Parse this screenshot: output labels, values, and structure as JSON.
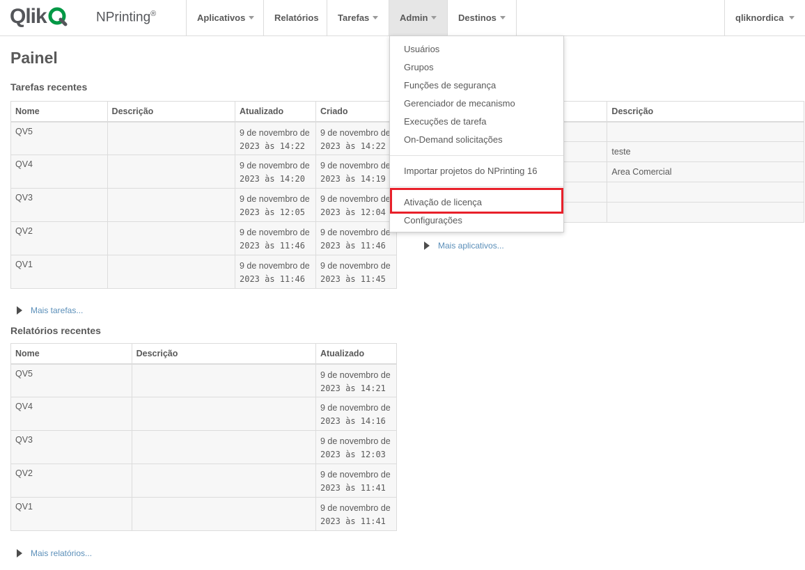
{
  "header": {
    "logo_text": "Qlik",
    "product_name": "NPrinting",
    "product_mark": "®",
    "nav": [
      {
        "label": "Aplicativos"
      },
      {
        "label": "Relatórios"
      },
      {
        "label": "Tarefas"
      },
      {
        "label": "Admin"
      },
      {
        "label": "Destinos"
      }
    ],
    "user": "qliknordica"
  },
  "page": {
    "title": "Painel"
  },
  "tasks": {
    "title": "Tarefas recentes",
    "columns": [
      "Nome",
      "Descrição",
      "Atualizado",
      "Criado"
    ],
    "rows": [
      {
        "name": "QV5",
        "description": "",
        "updated_date": "9 de novembro de",
        "updated_time": "2023 às 14:22",
        "created_date": "9 de novembro de",
        "created_time": "2023 às 14:22"
      },
      {
        "name": "QV4",
        "description": "",
        "updated_date": "9 de novembro de",
        "updated_time": "2023 às 14:20",
        "created_date": "9 de novembro de",
        "created_time": "2023 às 14:19"
      },
      {
        "name": "QV3",
        "description": "",
        "updated_date": "9 de novembro de",
        "updated_time": "2023 às 12:05",
        "created_date": "9 de novembro de",
        "created_time": "2023 às 12:04"
      },
      {
        "name": "QV2",
        "description": "",
        "updated_date": "9 de novembro de",
        "updated_time": "2023 às 11:46",
        "created_date": "9 de novembro de",
        "created_time": "2023 às 11:46"
      },
      {
        "name": "QV1",
        "description": "",
        "updated_date": "9 de novembro de",
        "updated_time": "2023 às 11:46",
        "created_date": "9 de novembro de",
        "created_time": "2023 às 11:45"
      }
    ],
    "more": "Mais tarefas..."
  },
  "reports": {
    "title": "Relatórios recentes",
    "columns": [
      "Nome",
      "Descrição",
      "Atualizado"
    ],
    "rows": [
      {
        "name": "QV5",
        "description": "",
        "updated_date": "9 de novembro de",
        "updated_time": "2023 às 14:21"
      },
      {
        "name": "QV4",
        "description": "",
        "updated_date": "9 de novembro de",
        "updated_time": "2023 às 14:16"
      },
      {
        "name": "QV3",
        "description": "",
        "updated_date": "9 de novembro de",
        "updated_time": "2023 às 12:03"
      },
      {
        "name": "QV2",
        "description": "",
        "updated_date": "9 de novembro de",
        "updated_time": "2023 às 11:41"
      },
      {
        "name": "QV1",
        "description": "",
        "updated_date": "9 de novembro de",
        "updated_time": "2023 às 11:41"
      }
    ],
    "more": "Mais relatórios..."
  },
  "apps": {
    "columns": [
      "",
      "Descrição"
    ],
    "rows": [
      {
        "description": ""
      },
      {
        "description": "teste"
      },
      {
        "description": "Area Comercial"
      },
      {
        "description": ""
      },
      {
        "description": ""
      }
    ],
    "more": "Mais aplicativos..."
  },
  "admin_menu": {
    "items": [
      "Usuários",
      "Grupos",
      "Funções de segurança",
      "Gerenciador de mecanismo",
      "Execuções de tarefa",
      "On-Demand solicitações",
      "Importar projetos do NPrinting 16",
      "Ativação de licença",
      "Configurações"
    ]
  },
  "colors": {
    "accent_green": "#009845",
    "highlight_red": "#e8202a",
    "link_blue": "#5b8fb9",
    "text_gray": "#595959"
  }
}
